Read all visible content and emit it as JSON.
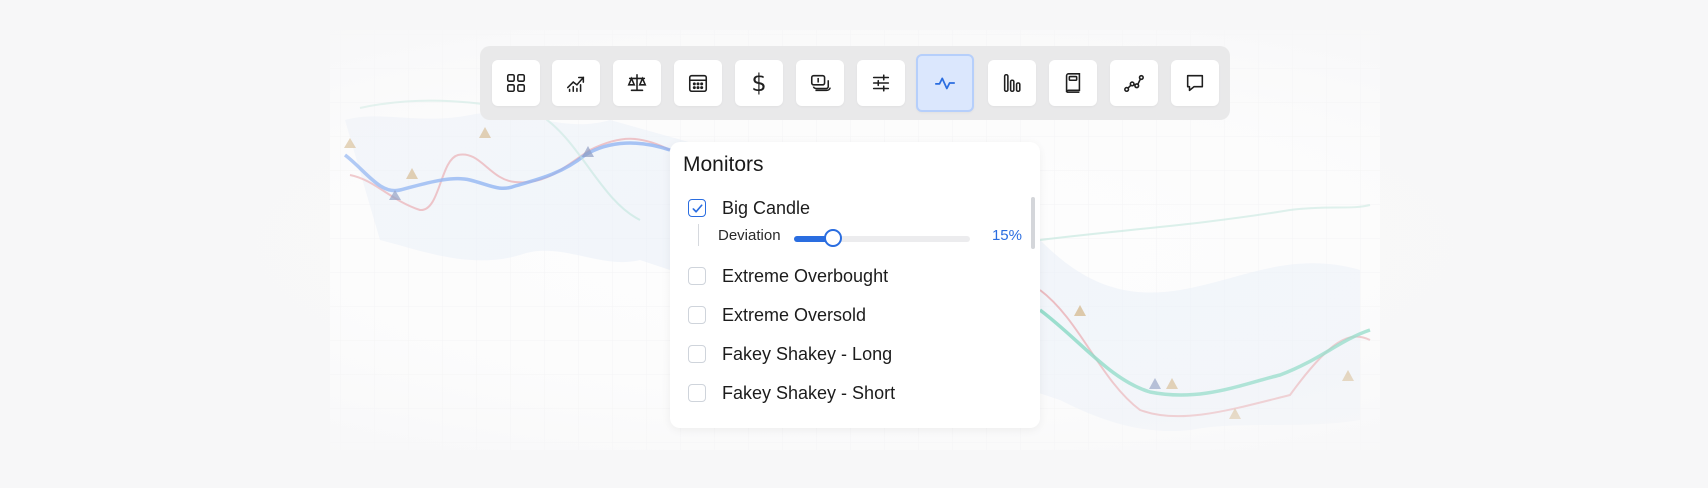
{
  "toolbar": {
    "tools": [
      {
        "icon": "grid-icon"
      },
      {
        "icon": "chart-trend-icon"
      },
      {
        "icon": "scales-icon"
      },
      {
        "icon": "calendar-icon"
      },
      {
        "icon": "dollar-icon",
        "glyph": "$"
      },
      {
        "icon": "money-stack-icon"
      },
      {
        "icon": "sliders-icon"
      },
      {
        "icon": "pulse-icon",
        "active": true
      },
      {
        "icon": "bars-icon"
      },
      {
        "icon": "book-icon"
      },
      {
        "icon": "line-points-icon"
      },
      {
        "icon": "chat-icon"
      }
    ],
    "accent": "#2a6de0"
  },
  "monitors": {
    "title": "Monitors",
    "items": [
      {
        "label": "Big Candle",
        "checked": true
      },
      {
        "label": "Extreme Overbought",
        "checked": false
      },
      {
        "label": "Extreme Oversold",
        "checked": false
      },
      {
        "label": "Fakey Shakey - Long",
        "checked": false
      },
      {
        "label": "Fakey Shakey - Short",
        "checked": false
      }
    ],
    "deviation": {
      "label": "Deviation",
      "value_text": "15%",
      "fraction": 0.22
    }
  }
}
